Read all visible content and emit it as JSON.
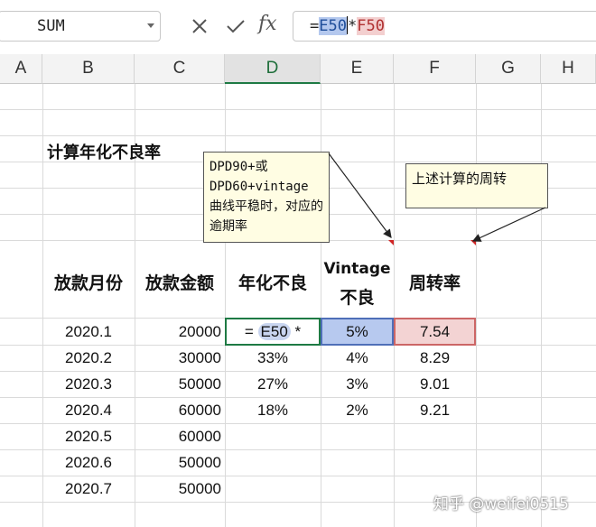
{
  "formula_bar": {
    "name_box": "SUM",
    "cancel_icon": "close-icon",
    "confirm_icon": "check-icon",
    "fx_label": "fx",
    "formula_prefix": "=",
    "formula_ref1": "E50",
    "formula_op": "*",
    "formula_ref2": "F50"
  },
  "columns": [
    "A",
    "B",
    "C",
    "D",
    "E",
    "F",
    "G",
    "H"
  ],
  "title": "计算年化不良率",
  "notes": {
    "note1": "DPD90+或 DPD60+vintage 曲线平稳时，对应的逾期率",
    "note2": "上述计算的周转"
  },
  "table": {
    "headers": {
      "month": "放款月份",
      "amount": "放款金额",
      "annual_bad": "年化不良",
      "vintage_line1": "Vintage",
      "vintage_line2": "不良",
      "turnover": "周转率"
    },
    "editing_cell": {
      "prefix": "=",
      "ref": "E50",
      "suffix": "*"
    },
    "rows": [
      {
        "month": "2020.1",
        "amount": "20000",
        "annual_bad": "",
        "vintage": "5%",
        "turnover": "7.54"
      },
      {
        "month": "2020.2",
        "amount": "30000",
        "annual_bad": "33%",
        "vintage": "4%",
        "turnover": "8.29"
      },
      {
        "month": "2020.3",
        "amount": "50000",
        "annual_bad": "27%",
        "vintage": "3%",
        "turnover": "9.01"
      },
      {
        "month": "2020.4",
        "amount": "60000",
        "annual_bad": "18%",
        "vintage": "2%",
        "turnover": "9.21"
      },
      {
        "month": "2020.5",
        "amount": "60000",
        "annual_bad": "",
        "vintage": "",
        "turnover": ""
      },
      {
        "month": "2020.6",
        "amount": "50000",
        "annual_bad": "",
        "vintage": "",
        "turnover": ""
      },
      {
        "month": "2020.7",
        "amount": "50000",
        "annual_bad": "",
        "vintage": "",
        "turnover": ""
      }
    ]
  },
  "watermark": "知乎 @weifei0515",
  "colors": {
    "active_border": "#1e7a44",
    "ref_blue": "#b7c9ef",
    "ref_red": "#f3d3d3"
  }
}
